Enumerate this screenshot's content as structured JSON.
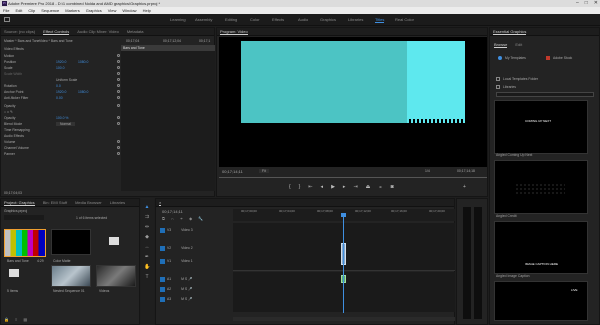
{
  "window": {
    "title": "Adobe Premiere Pro 2018 - D:\\1 combined Nolda and AMD graphics\\Graphics.prproj *",
    "app_icon": "Pr"
  },
  "menu": [
    "File",
    "Edit",
    "Clip",
    "Sequence",
    "Markers",
    "Graphics",
    "View",
    "Window",
    "Help"
  ],
  "workspaces": [
    "Learning",
    "Assembly",
    "Editing",
    "Color",
    "Effects",
    "Audio",
    "Graphics",
    "Libraries",
    "Titles",
    "Real Color"
  ],
  "workspace_active_index": 8,
  "source_panel": {
    "tabs": [
      "Source: (no clips)",
      "Effect Controls",
      "Audio Clip Mixer: Video",
      "Metadata"
    ],
    "active_tab_index": 1,
    "master_line": "Master * Bars and Tone",
    "clip_line": "Video * Bars and Tone",
    "timecode_a": "00;17;04",
    "timecode_b": "00;17;12;04",
    "timecode_c": "00;17;1",
    "clip_name": "Bars and Tone",
    "section_video": "Video Effects",
    "rows": [
      {
        "label": "Motion",
        "v1": "",
        "v2": ""
      },
      {
        "label": "Position",
        "v1": "1920.0",
        "v2": "1080.0"
      },
      {
        "label": "Scale",
        "v1": "100.0",
        "v2": ""
      },
      {
        "label": "Scale Width",
        "v1": "",
        "v2": ""
      },
      {
        "label": "",
        "v1": "",
        "v2": "Uniform Scale"
      },
      {
        "label": "Rotation",
        "v1": "0.0",
        "v2": ""
      },
      {
        "label": "Anchor Point",
        "v1": "1920.0",
        "v2": "1080.0"
      },
      {
        "label": "Anti-flicker Filter",
        "v1": "0.00",
        "v2": ""
      },
      {
        "label": "Opacity",
        "v1": "",
        "v2": ""
      },
      {
        "label": "",
        "v1": "",
        "v2": ""
      },
      {
        "label": "Opacity",
        "v1": "100.0 %",
        "v2": ""
      },
      {
        "label": "Blend Mode",
        "v1": "Normal",
        "v2": ""
      },
      {
        "label": "Time Remapping",
        "v1": "",
        "v2": ""
      },
      {
        "label": "Audio Effects",
        "v1": "",
        "v2": ""
      },
      {
        "label": "Volume",
        "v1": "",
        "v2": ""
      },
      {
        "label": "Channel Volume",
        "v1": "",
        "v2": ""
      },
      {
        "label": "Panner",
        "v1": "",
        "v2": ""
      }
    ],
    "footer_timecode": "00;17;04;03"
  },
  "program": {
    "title": "Program: Video",
    "timecode": "00;17;14;11",
    "fit": "Fit",
    "quality": "1/4",
    "duration": "00;17;14;18"
  },
  "project": {
    "tabs": [
      "Project: Graphics",
      "Bin: EMI Stuff",
      "Media Browser",
      "Libraries"
    ],
    "file": "Graphics.prproj",
    "selected": "1 of 6 items selected",
    "items": [
      {
        "name": "Bars and Tone",
        "dur": "4:29"
      },
      {
        "name": "Color Matte",
        "dur": ""
      },
      {
        "name": "Bins",
        "dur": ""
      },
      {
        "name": "5 Items",
        "dur": ""
      },
      {
        "name": "Nested Sequence 01",
        "dur": "14:11"
      },
      {
        "name": "Videos",
        "dur": ""
      }
    ]
  },
  "timeline": {
    "timecode": "00;17;14;11",
    "ruler": [
      "00;17;00;00",
      "00;17;04;00",
      "00;17;08;00",
      "00;17;12;00",
      "00;17;16;00",
      "00;17;20;00",
      "00;17;2"
    ],
    "tracks_video": [
      "V3",
      "V2",
      "V1"
    ],
    "tracks_audio": [
      "A1",
      "A2",
      "A3"
    ],
    "video_labels": [
      "Video 3",
      "Video 2",
      "Video 1"
    ]
  },
  "essential_graphics": {
    "title": "Essential Graphics",
    "tabs": [
      "Browse",
      "Edit"
    ],
    "my_templates": "My Templates",
    "adobe_stock": "Adobe Stock",
    "local_folder": "Local Templates Folder",
    "libraries": "Libraries",
    "items": [
      {
        "label": "Angled Coming Up Next",
        "overlay": "COMING UP NEXT"
      },
      {
        "label": "Angled Credit",
        "overlay": ""
      },
      {
        "label": "Angled Image Caption",
        "overlay": "IMAGE CAPTION HERE"
      },
      {
        "label": "",
        "overlay": "LIVE"
      }
    ],
    "search_overlay": "HEADLINE"
  }
}
